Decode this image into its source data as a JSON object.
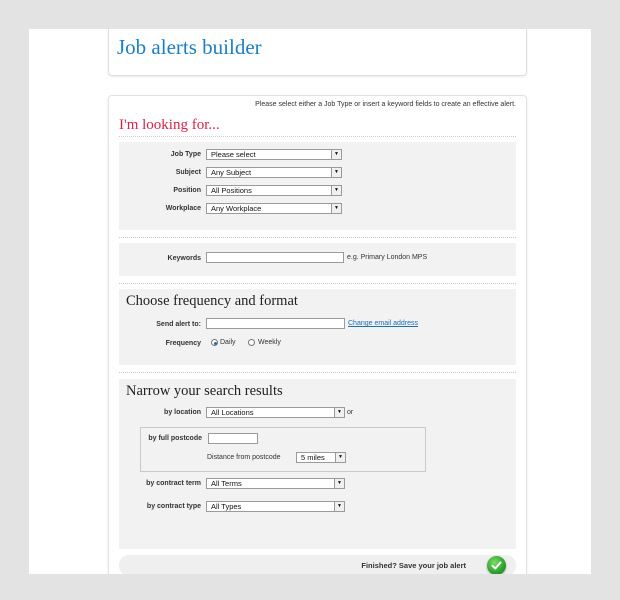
{
  "page_title": "Job alerts builder",
  "intro_text": "Please select either a Job Type or insert a keyword fields to create an effective alert.",
  "looking_heading": "I'm looking for...",
  "job_type": {
    "label": "Job Type",
    "value": "Please select"
  },
  "subject": {
    "label": "Subject",
    "value": "Any Subject"
  },
  "position": {
    "label": "Position",
    "value": "All Positions"
  },
  "workplace": {
    "label": "Workplace",
    "value": "Any Workplace"
  },
  "keywords": {
    "label": "Keywords",
    "value": "",
    "hint": "e.g. Primary London MPS"
  },
  "frequency_section": {
    "heading": "Choose frequency and format",
    "send_label": "Send alert to:",
    "email_value": "",
    "change_email_link": "Change email address",
    "frequency_label": "Frequency",
    "options": [
      {
        "label": "Daily",
        "selected": true
      },
      {
        "label": "Weekly",
        "selected": false
      }
    ]
  },
  "narrow_section": {
    "heading": "Narrow your search results",
    "location_label": "by location",
    "location_value": "All Locations",
    "or_text": "or",
    "postcode_label": "by full postcode",
    "postcode_value": "",
    "distance_label": "Distance from postcode",
    "distance_value": "5 miles",
    "contract_term_label": "by contract term",
    "contract_term_value": "All Terms",
    "contract_type_label": "by contract type",
    "contract_type_value": "All Types"
  },
  "finish_text": "Finished? Save your job alert",
  "colors": {
    "title": "#1a7fc6",
    "heading_red": "#d8254a",
    "link": "#1a6fb5",
    "go_green": "#2aa02c"
  }
}
